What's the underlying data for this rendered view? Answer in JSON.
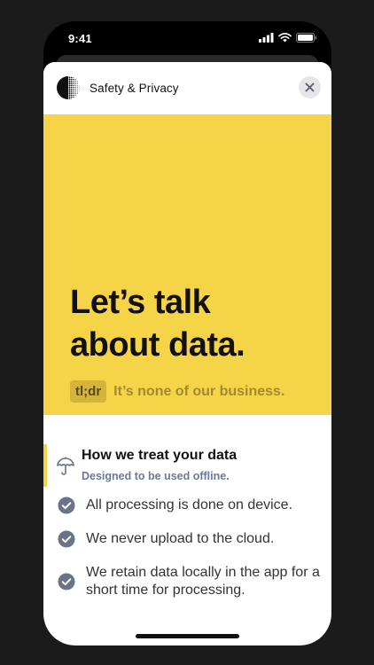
{
  "status_bar": {
    "time": "9:41",
    "icons": [
      "signal-icon",
      "wifi-icon",
      "battery-icon"
    ]
  },
  "sheet": {
    "title": "Safety & Privacy",
    "logo_icon": "dotted-circle-logo",
    "close_icon": "close-icon"
  },
  "hero": {
    "title_line1": "Let’s talk",
    "title_line2": "about data.",
    "badge": "tl;dr",
    "tagline": "It’s none of our business.",
    "background_color": "#f6d448"
  },
  "section": {
    "icon": "umbrella-icon",
    "title": "How we treat your data",
    "subtitle": "Designed to be used offline.",
    "items": [
      {
        "icon": "check-circle-icon",
        "text": "All processing is done on device."
      },
      {
        "icon": "check-circle-icon",
        "text": "We never upload to the cloud."
      },
      {
        "icon": "check-circle-icon",
        "text": "We retain data locally in the app for a short time for processing."
      }
    ]
  },
  "colors": {
    "accent_yellow": "#f6d448",
    "check_gray": "#6a7387",
    "subtitle_blue_gray": "#6a7a95"
  }
}
